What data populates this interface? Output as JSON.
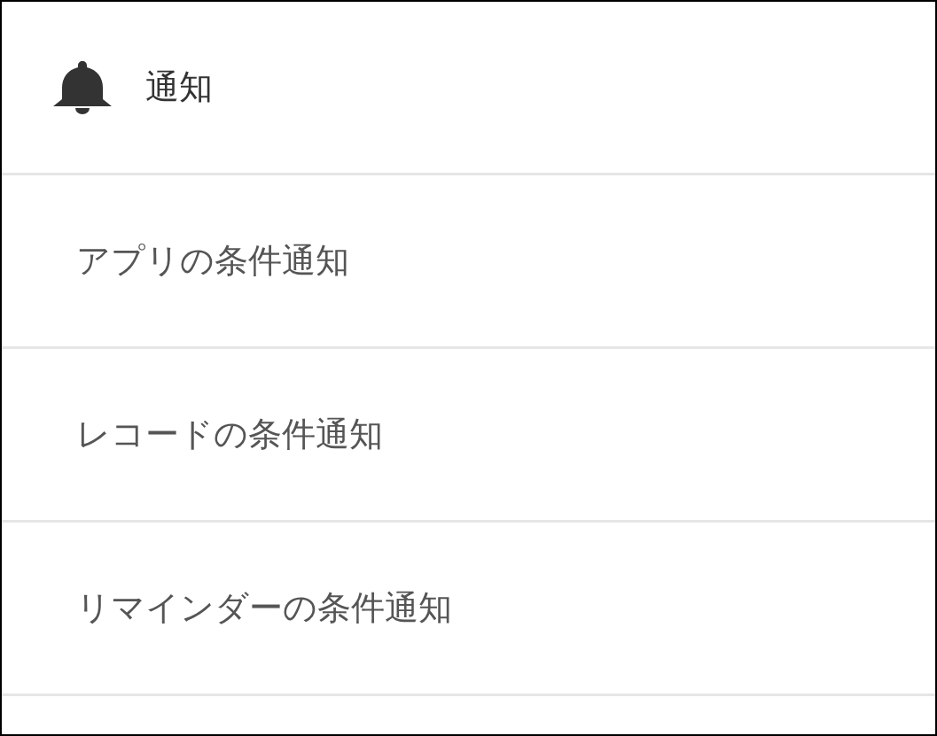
{
  "header": {
    "title": "通知"
  },
  "items": [
    {
      "label": "アプリの条件通知"
    },
    {
      "label": "レコードの条件通知"
    },
    {
      "label": "リマインダーの条件通知"
    }
  ]
}
